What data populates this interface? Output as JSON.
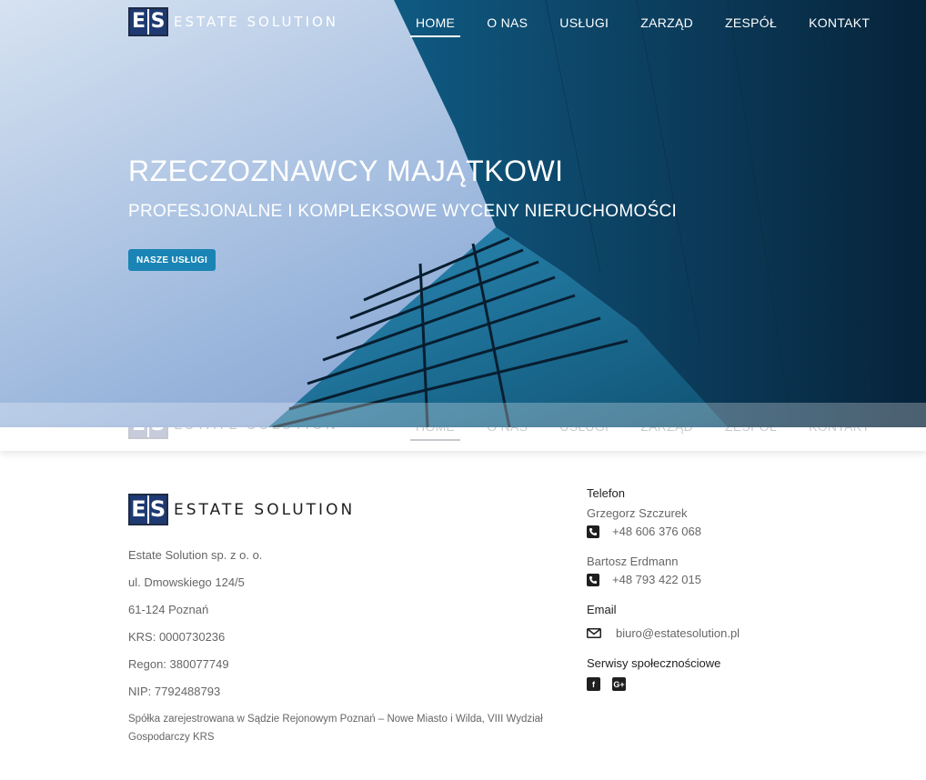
{
  "brand": {
    "letter1": "E",
    "letter2": "S",
    "wordmark": "ESTATE SOLUTION"
  },
  "nav": {
    "items": [
      {
        "label": "HOME",
        "active": true
      },
      {
        "label": "O NAS"
      },
      {
        "label": "USŁUGI"
      },
      {
        "label": "ZARZĄD"
      },
      {
        "label": "ZESPÓŁ"
      },
      {
        "label": "KONTAKT"
      }
    ]
  },
  "hero": {
    "title": "RZECZOZNAWCY MAJĄTKOWI",
    "subtitle": "PROFESJONALNE I KOMPLEKSOWE WYCENY NIERUCHOMOŚCI",
    "cta_label": "NASZE USŁUGI"
  },
  "company": {
    "lines": [
      "Estate Solution sp. z o. o.",
      "ul. Dmowskiego 124/5",
      "61-124 Poznań",
      "KRS: 0000730236",
      "Regon: 380077749",
      "NIP: 7792488793"
    ],
    "note": "Spółka zarejestrowana w Sądzie Rejonowym Poznań – Nowe Miasto i Wilda, VIII Wydział Gospodarczy KRS"
  },
  "contact": {
    "phone_heading": "Telefon",
    "people": [
      {
        "name": "Grzegorz Szczurek",
        "phone": "+48 606 376 068"
      },
      {
        "name": "Bartosz Erdmann",
        "phone": "+48 793 422 015"
      }
    ],
    "email_heading": "Email",
    "email": "biuro@estatesolution.pl",
    "social_heading": "Serwisy społecznościowe",
    "social": [
      {
        "icon": "facebook-icon",
        "glyph": "f"
      },
      {
        "icon": "google-plus-icon",
        "glyph": "G+"
      }
    ]
  },
  "colors": {
    "brand_navy": "#1f3a72",
    "accent_button": "#1a84b5"
  }
}
